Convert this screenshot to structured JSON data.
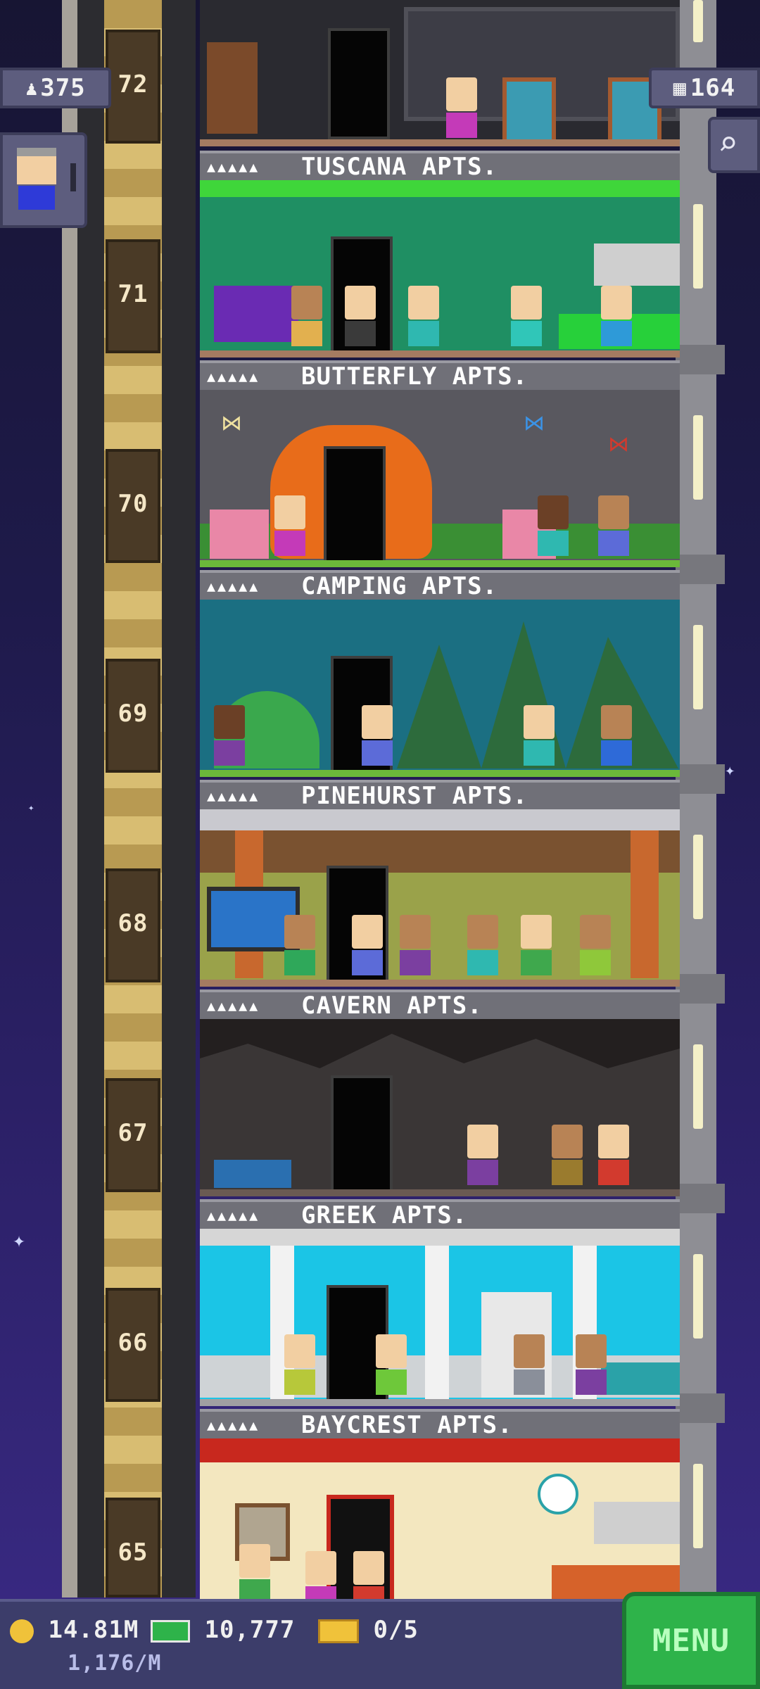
{
  "hud": {
    "population": "375",
    "floors": "164",
    "coins": "14.81M",
    "coins_per_min": "1,176/M",
    "bux": "10,777",
    "tickets": "0/5",
    "menu_label": "MENU"
  },
  "floors": [
    {
      "number": "72",
      "name": ""
    },
    {
      "number": "71",
      "name": "TUSCANA APTS."
    },
    {
      "number": "70",
      "name": "BUTTERFLY APTS."
    },
    {
      "number": "69",
      "name": "CAMPING APTS."
    },
    {
      "number": "68",
      "name": "PINEHURST APTS."
    },
    {
      "number": "67",
      "name": "CAVERN APTS."
    },
    {
      "number": "66",
      "name": "GREEK APTS."
    },
    {
      "number": "65",
      "name": "BAYCREST APTS."
    }
  ],
  "colors": {
    "menu_green": "#2eb34a",
    "hud_panel": "#5d5d7e",
    "night_sky": "#1e1a4a"
  },
  "icons": [
    "person-icon",
    "building-icon",
    "magnifier-icon",
    "coin-icon",
    "bux-icon",
    "ticket-icon"
  ]
}
